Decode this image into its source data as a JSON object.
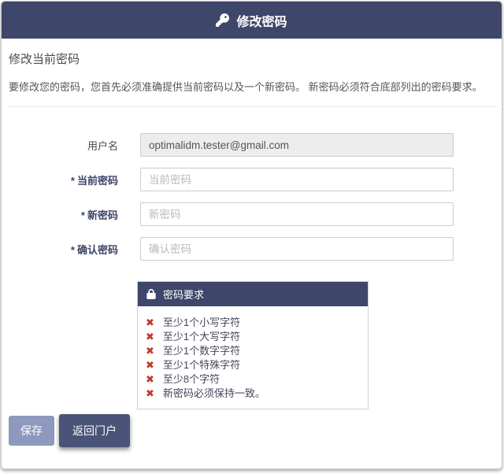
{
  "header": {
    "title": "修改密码"
  },
  "intro": {
    "heading": "修改当前密码",
    "description": "要修改您的密码，您首先必须准确提供当前密码以及一个新密码。 新密码必须符合底部列出的密码要求。"
  },
  "form": {
    "required_marker": "*",
    "fields": {
      "username": {
        "label": "用户名",
        "value": "optimalidm.tester@gmail.com"
      },
      "current_password": {
        "label": "当前密码",
        "placeholder": "当前密码"
      },
      "new_password": {
        "label": "新密码",
        "placeholder": "新密码"
      },
      "confirm_password": {
        "label": "确认密码",
        "placeholder": "确认密码"
      }
    }
  },
  "requirements": {
    "title": "密码要求",
    "x_glyph": "✖",
    "items": [
      "至少1个小写字符",
      "至少1个大写字符",
      "至少1个数字字符",
      "至少1个特殊字符",
      "至少8个字符",
      "新密码必须保持一致。"
    ]
  },
  "buttons": {
    "save": "保存",
    "back": "返回门户"
  },
  "colors": {
    "navy": "#3e4769",
    "muted_button": "#8d9abd",
    "dark_button": "#4a5478",
    "error_red": "#c0392b"
  }
}
